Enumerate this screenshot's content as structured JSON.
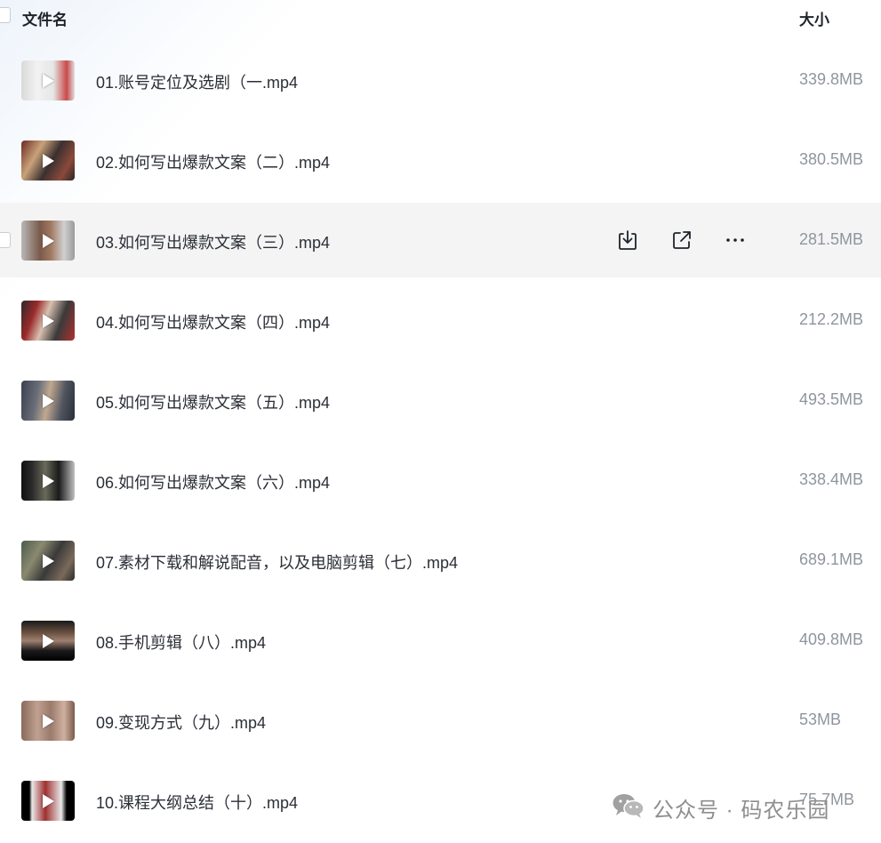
{
  "header": {
    "name_label": "文件名",
    "size_label": "大小"
  },
  "files": [
    {
      "name": "01.账号定位及选剧（一.mp4",
      "size": "339.8MB"
    },
    {
      "name": "02.如何写出爆款文案（二）.mp4",
      "size": "380.5MB"
    },
    {
      "name": "03.如何写出爆款文案（三）.mp4",
      "size": "281.5MB"
    },
    {
      "name": "04.如何写出爆款文案（四）.mp4",
      "size": "212.2MB"
    },
    {
      "name": "05.如何写出爆款文案（五）.mp4",
      "size": "493.5MB"
    },
    {
      "name": "06.如何写出爆款文案（六）.mp4",
      "size": "338.4MB"
    },
    {
      "name": "07.素材下载和解说配音，以及电脑剪辑（七）.mp4",
      "size": "689.1MB"
    },
    {
      "name": "08.手机剪辑（八）.mp4",
      "size": "409.8MB"
    },
    {
      "name": "09.变现方式（九）.mp4",
      "size": "53MB"
    },
    {
      "name": "10.课程大纲总结（十）.mp4",
      "size": "75.7MB"
    }
  ],
  "hovered_row_actions": [
    "download-icon",
    "share-icon",
    "more-icon"
  ],
  "watermark": {
    "text": "公众号 · 码农乐园",
    "icon": "wechat-icon"
  }
}
